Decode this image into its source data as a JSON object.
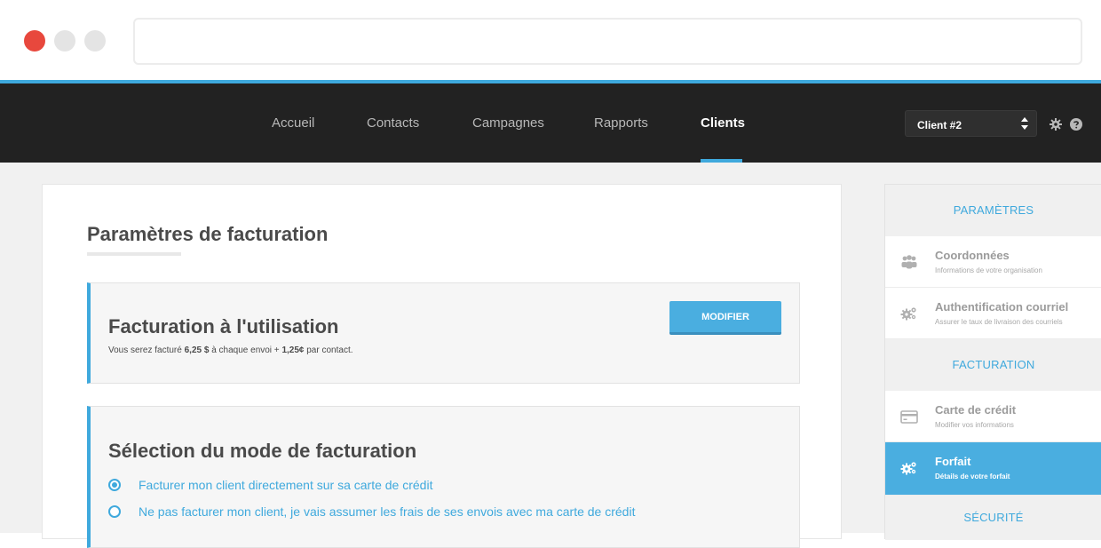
{
  "browser": {
    "url": ""
  },
  "topnav": {
    "items": [
      {
        "label": "Accueil"
      },
      {
        "label": "Contacts"
      },
      {
        "label": "Campagnes"
      },
      {
        "label": "Rapports"
      },
      {
        "label": "Clients"
      }
    ],
    "active": "Clients",
    "client_select": "Client #2",
    "accent_color": "#3fa9dd"
  },
  "main": {
    "title": "Paramètres de facturation",
    "usage_panel": {
      "title": "Facturation à l'utilisation",
      "note_prefix": "Vous serez facturé ",
      "note_amount": "6,25 $",
      "note_middle": " à chaque envoi + ",
      "note_rate": "1,25¢",
      "note_suffix": " par contact.",
      "modify_label": "MODIFIER"
    },
    "mode_panel": {
      "title": "Sélection du mode de facturation",
      "options": [
        {
          "label": "Facturer mon client directement sur sa carte de crédit",
          "checked": true
        },
        {
          "label": "Ne pas facturer mon client, je vais assumer les frais de ses envois avec ma carte de crédit",
          "checked": false
        }
      ]
    }
  },
  "sidebar": {
    "sections": [
      {
        "heading": "PARAMÈTRES"
      },
      {
        "heading": "FACTURATION"
      },
      {
        "heading": "SÉCURITÉ"
      }
    ],
    "items": [
      {
        "title": "Coordonnées",
        "subtitle": "Informations de votre organisation",
        "icon": "users-icon"
      },
      {
        "title": "Authentification courriel",
        "subtitle": "Assurer le taux de livraison des courriels",
        "icon": "gears-icon"
      },
      {
        "title": "Carte de crédit",
        "subtitle": "Modifier vos informations",
        "icon": "credit-card-icon"
      },
      {
        "title": "Forfait",
        "subtitle": "Détails de votre forfait",
        "icon": "gears-icon",
        "active": true
      }
    ]
  }
}
